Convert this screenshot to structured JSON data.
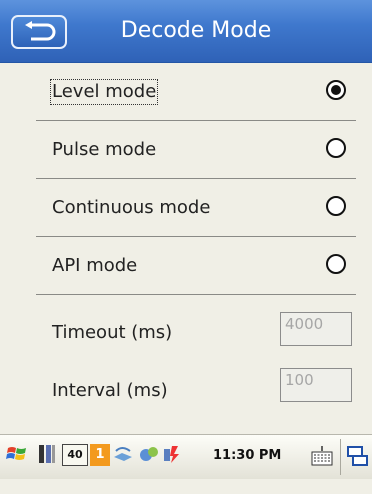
{
  "header": {
    "title": "Decode Mode",
    "back_icon": "back-arrow-icon"
  },
  "modes": [
    {
      "label": "Level mode",
      "selected": true
    },
    {
      "label": "Pulse mode",
      "selected": false
    },
    {
      "label": "Continuous mode",
      "selected": false
    },
    {
      "label": "API mode",
      "selected": false
    }
  ],
  "fields": {
    "timeout": {
      "label": "Timeout (ms)",
      "value": "4000"
    },
    "interval": {
      "label": "Interval (ms)",
      "value": "100"
    }
  },
  "taskbar": {
    "clock": "11:30 PM",
    "badge_40": "40",
    "badge_1": "1",
    "accent": "#3f78cd"
  }
}
